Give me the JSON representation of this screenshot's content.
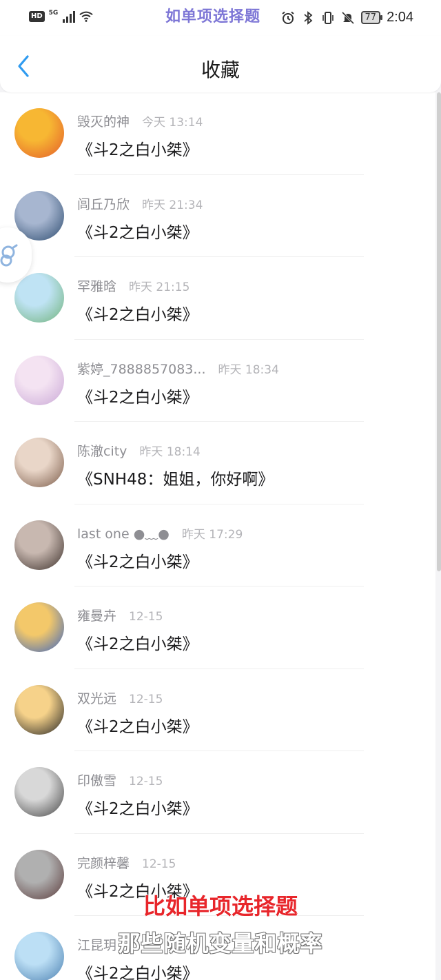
{
  "status_bar": {
    "hd": "HD",
    "network": "5G",
    "overlay_text": "如单项选择题",
    "battery": "77",
    "time": "2:04"
  },
  "header": {
    "title": "收藏",
    "back_icon": "chevron-left-icon",
    "accent_color": "#2f9bf0"
  },
  "items": [
    {
      "name": "毁灭的神",
      "time": "今天 13:14",
      "title": "《斗2之白小桀》",
      "avatar_colors": [
        "#f7b733",
        "#e35b2a"
      ]
    },
    {
      "name": "闾丘乃欣",
      "time": "昨天 21:34",
      "title": "《斗2之白小桀》",
      "avatar_colors": [
        "#a7b6d0",
        "#2b4a6e"
      ]
    },
    {
      "name": "罕雅晗",
      "time": "昨天 21:15",
      "title": "《斗2之白小桀》",
      "avatar_colors": [
        "#bfe3f4",
        "#6fb27a"
      ]
    },
    {
      "name": "紫婷_7888857083...",
      "time": "昨天 18:34",
      "title": "《斗2之白小桀》",
      "avatar_colors": [
        "#f4e3f2",
        "#c9a7d6"
      ]
    },
    {
      "name": "陈澈city",
      "time": "昨天 18:14",
      "title": "《SNH48：姐姐，你好啊》",
      "avatar_colors": [
        "#e9d6c8",
        "#7a5a48"
      ]
    },
    {
      "name": "last one ●﹏●",
      "time": "昨天 17:29",
      "title": "《斗2之白小桀》",
      "avatar_colors": [
        "#c8b8b0",
        "#3b2f2a"
      ]
    },
    {
      "name": "雍曼卉",
      "time": "12-15",
      "title": "《斗2之白小桀》",
      "avatar_colors": [
        "#f3c86a",
        "#3a64c0"
      ]
    },
    {
      "name": "双光远",
      "time": "12-15",
      "title": "《斗2之白小桀》",
      "avatar_colors": [
        "#f6d28a",
        "#222222"
      ]
    },
    {
      "name": "印傲雪",
      "time": "12-15",
      "title": "《斗2之白小桀》",
      "avatar_colors": [
        "#d8d8d8",
        "#444444"
      ]
    },
    {
      "name": "完颜梓馨",
      "time": "12-15",
      "title": "《斗2之白小桀》",
      "avatar_colors": [
        "#b0b0b0",
        "#5a3a3a"
      ]
    },
    {
      "name": "江昆玥",
      "time": "",
      "title": "《斗2之白小桀》",
      "avatar_colors": [
        "#bcdff5",
        "#4a7fb0"
      ]
    }
  ],
  "captions": {
    "red": "比如单项选择题",
    "white": "那些随机变量和概率"
  }
}
